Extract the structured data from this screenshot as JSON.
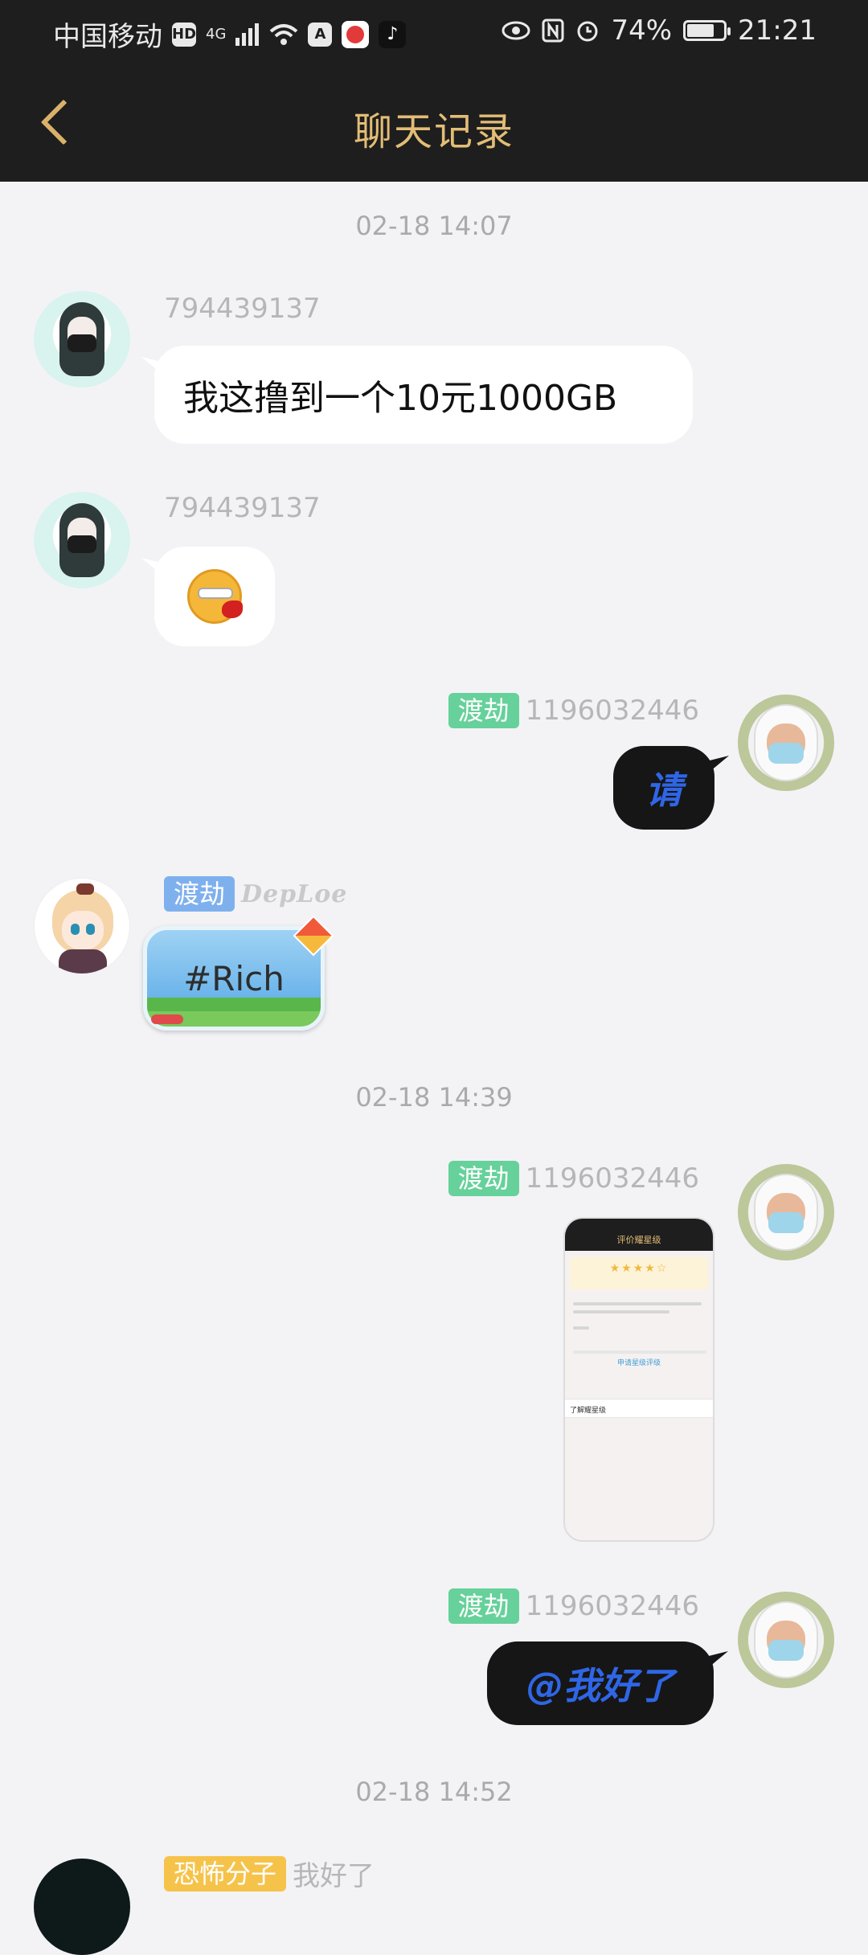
{
  "status_bar": {
    "carrier": "中国移动",
    "hd": "HD",
    "network": "4G",
    "battery_percent": "74%",
    "battery_level": 0.74,
    "time": "21:21"
  },
  "header": {
    "title": "聊天记录"
  },
  "messages": [
    {
      "time": "02-18 14:07"
    },
    {
      "sender": "794439137",
      "text": "我这撸到一个10元1000GB"
    },
    {
      "sender": "794439137",
      "emoji": "emoji-sticker"
    },
    {
      "badge": "渡劫",
      "sender": "1196032446",
      "text": "请"
    },
    {
      "badge": "渡劫",
      "nickname_style": "DepLoe",
      "text": "#Rich"
    },
    {
      "time": "02-18 14:39"
    },
    {
      "badge": "渡劫",
      "sender": "1196032446",
      "image": {
        "title": "评价耀星级",
        "link": "申请星级评级",
        "row": "了解耀星级"
      }
    },
    {
      "badge": "渡劫",
      "sender": "1196032446",
      "text": "@我好了"
    },
    {
      "time": "02-18 14:52"
    },
    {
      "badge": "恐怖分子",
      "preview": "我好了"
    }
  ],
  "colors": {
    "header_bg": "#1e1e1e",
    "header_title": "#e3bd76",
    "badge_green": "#66d19a",
    "badge_blue": "#7fb0ee",
    "badge_yellow": "#f6c34a",
    "dark_bubble_text": "#2f66e6"
  }
}
